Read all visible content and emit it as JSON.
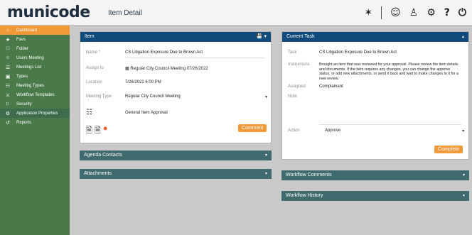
{
  "app": {
    "logo": "municode",
    "page_title": "Item Detail"
  },
  "topbar": {
    "icons": [
      "bell-icon",
      "user-card-icon",
      "person-icon",
      "gear-icon",
      "help-icon",
      "power-icon"
    ],
    "glyphs": [
      "✶",
      "☺",
      "♙",
      "⚙",
      "?",
      "⏻"
    ]
  },
  "sidebar": {
    "items": [
      {
        "label": "Dashboard",
        "icon": "⌂"
      },
      {
        "label": "Favs",
        "icon": "★"
      },
      {
        "label": "Folder",
        "icon": "□"
      },
      {
        "label": "Users Meeting",
        "icon": "☺"
      },
      {
        "label": "Meetings List",
        "icon": "☰"
      },
      {
        "label": "Types",
        "icon": "▣"
      },
      {
        "label": "Meeting Types",
        "icon": "☷"
      },
      {
        "label": "Workflow Templates",
        "icon": "⚔"
      },
      {
        "label": "Security",
        "icon": "⚐"
      },
      {
        "label": "Application Properties",
        "icon": "⚙"
      },
      {
        "label": "Reports",
        "icon": "↺"
      }
    ]
  },
  "item_panel": {
    "title": "Item",
    "fields": [
      {
        "label": "Name *",
        "value": "CS Litigation Exposure Due to Brown Act"
      },
      {
        "label": "Assign to",
        "value": "Regular City Council Meeting 07/26/2022"
      },
      {
        "label": "Location",
        "value": "7/26/2022 6:00 PM"
      },
      {
        "label": "Meeting Type",
        "value": "Regular City Council Meeting"
      }
    ],
    "approval": "General Item Approval",
    "button": "Comment"
  },
  "current_task": {
    "title": "Current Task",
    "fields": [
      {
        "label": "Task",
        "value": "CS Litigation Exposure Due to Brown Act"
      },
      {
        "label": "Instructions",
        "value": "Brought an item that was reviewed for your approval. Please review the item details and documents. If the item requires any changes, you can change the approve status, or add new attachments, or send it back and wait to make changes to it for a new review."
      },
      {
        "label": "Assigned",
        "value": "Complainant"
      },
      {
        "label": "Note",
        "value": ""
      },
      {
        "label": "Action",
        "value": "Approve"
      }
    ],
    "button": "Complete"
  },
  "sections": {
    "agenda_contacts": "Agenda Contacts",
    "attachments": "Attachments",
    "workflow_comments": "Workflow Comments",
    "workflow_history": "Workflow History"
  }
}
